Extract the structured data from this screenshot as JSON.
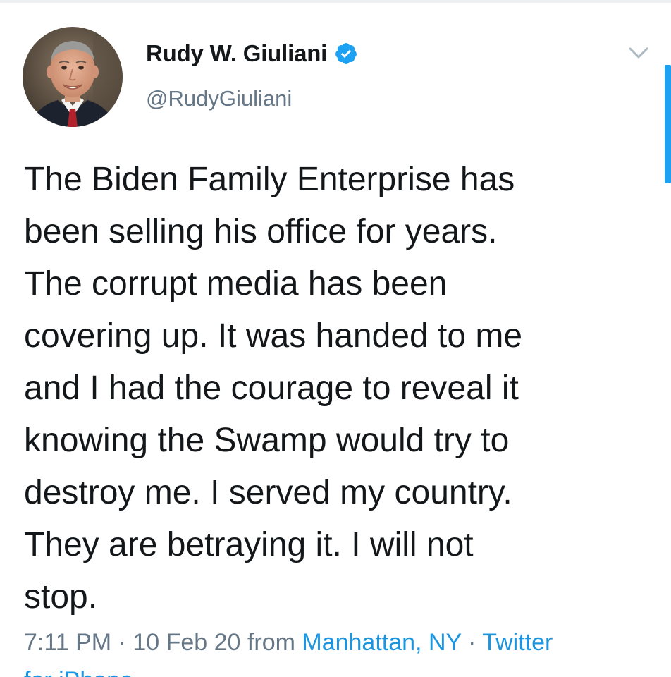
{
  "tweet": {
    "display_name": "Rudy W. Giuliani",
    "handle": "@RudyGiuliani",
    "verified": true,
    "text_lines": [
      "The Biden Family Enterprise has",
      "been selling his office for years.",
      "The corrupt media has been",
      "covering up. It was handed to me",
      "and I had the courage to reveal it",
      "knowing the Swamp would try to",
      "destroy me. I served my country.",
      "They are betraying it. I will not",
      "stop."
    ],
    "time": "7:11 PM",
    "separator": "·",
    "date": "10 Feb 20",
    "from_word": "from",
    "location": "Manhattan, NY",
    "source": "Twitter",
    "source_cut": "for iPhone"
  },
  "icons": {
    "verified": "verified-badge-icon",
    "menu": "chevron-down-icon"
  },
  "colors": {
    "text": "#14171a",
    "secondary": "#657786",
    "link": "#1b95e0",
    "accent": "#1da1f2"
  }
}
